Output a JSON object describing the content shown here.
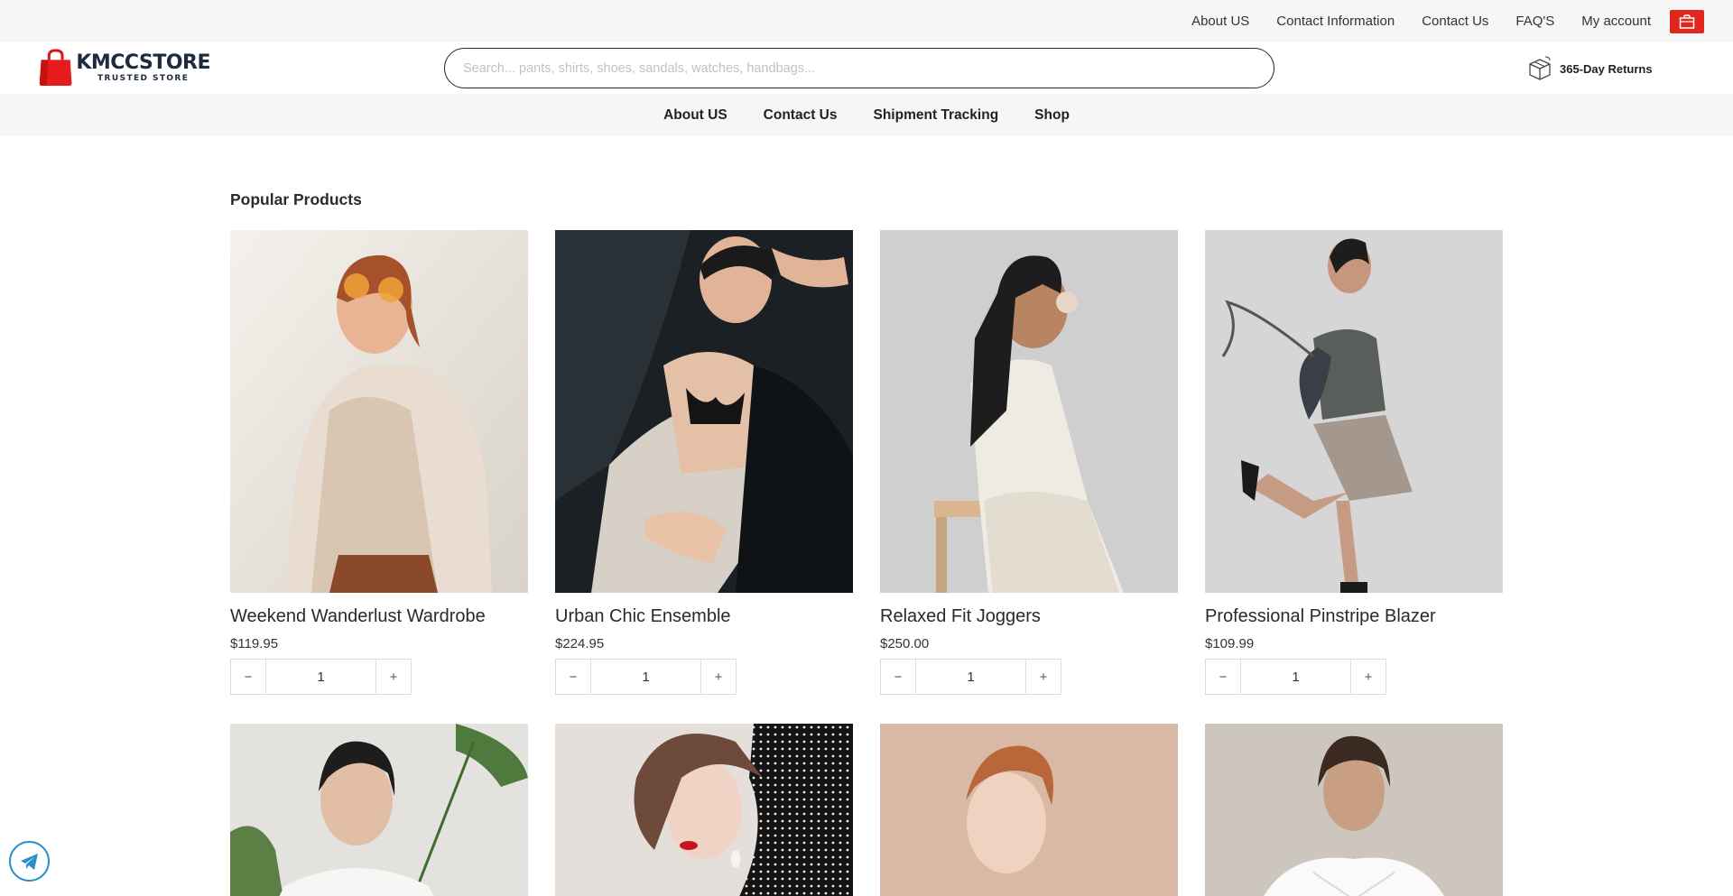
{
  "topbar": {
    "links": [
      "About US",
      "Contact Information",
      "Contact Us",
      "FAQ'S",
      "My account"
    ]
  },
  "header": {
    "logo_name": "KMCCSTORE",
    "logo_sub": "TRUSTED STORE",
    "search_placeholder": "Search... pants, shirts, shoes, sandals, watches, handbags...",
    "returns_label": "365-Day Returns"
  },
  "mainnav": {
    "links": [
      "About US",
      "Contact Us",
      "Shipment Tracking",
      "Shop"
    ]
  },
  "section": {
    "title": "Popular Products"
  },
  "products": [
    {
      "name": "Weekend Wanderlust Wardrobe",
      "price": "$119.95",
      "qty": "1"
    },
    {
      "name": "Urban Chic Ensemble",
      "price": "$224.95",
      "qty": "1"
    },
    {
      "name": "Relaxed Fit Joggers",
      "price": "$250.00",
      "qty": "1"
    },
    {
      "name": "Professional Pinstripe Blazer",
      "price": "$109.99",
      "qty": "1"
    }
  ],
  "qty_controls": {
    "minus": "−",
    "plus": "+"
  },
  "colors": {
    "brand_red": "#e0261e",
    "navy": "#1e2a3d",
    "telegram": "#2b90c9"
  }
}
